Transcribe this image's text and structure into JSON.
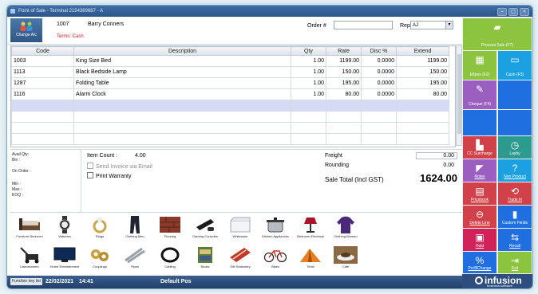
{
  "window": {
    "title": "Point of Sale - Terminal 2154389887 - A"
  },
  "account": {
    "change_label": "Change A/c",
    "code": "1007",
    "name": "Barry Conners",
    "terms": "Terms: Cash"
  },
  "order": {
    "label": "Order #",
    "value": ""
  },
  "rep": {
    "label": "Rep",
    "value": "AJ"
  },
  "table": {
    "headers": [
      "Code",
      "Description",
      "Qty",
      "Rate",
      "Disc %",
      "Extend"
    ],
    "rows": [
      {
        "code": "1003",
        "description": "King Size Bed",
        "qty": "1.00",
        "rate": "1199.00",
        "disc": "0.0000",
        "extend": "1199.00"
      },
      {
        "code": "1113",
        "description": "Black Bedside Lamp",
        "qty": "1.00",
        "rate": "150.00",
        "disc": "0.0000",
        "extend": "150.00"
      },
      {
        "code": "1287",
        "description": "Folding Table",
        "qty": "1.00",
        "rate": "195.00",
        "disc": "0.0000",
        "extend": "195.00"
      },
      {
        "code": "1116",
        "description": "Alarm Clock",
        "qty": "1.00",
        "rate": "80.00",
        "disc": "0.0000",
        "extend": "80.00"
      }
    ]
  },
  "stock": {
    "avail": "Avail Qty:",
    "bin": "Bin :",
    "on_order": "On Order :",
    "min": "Min :",
    "max": "Max :",
    "eoq": "EOQ :"
  },
  "summary": {
    "item_count_label": "Item Count :",
    "item_count": "4.00",
    "send_invoice": "Send Invoice via Email",
    "print_warranty": "Print Warranty",
    "freight_label": "Freight",
    "freight": "0.00",
    "rounding_label": "Rounding",
    "rounding": "0.00",
    "total_label": "Sale Total (Incl GST)",
    "total": "1624.00"
  },
  "categories": [
    {
      "label": "Furniture Bedroom",
      "icon": "bed-icon"
    },
    {
      "label": "Watches",
      "icon": "watch-icon"
    },
    {
      "label": "Rings",
      "icon": "ring-icon"
    },
    {
      "label": "Clothing Men",
      "icon": "trousers-icon"
    },
    {
      "label": "Flooring",
      "icon": "flooring-icon"
    },
    {
      "label": "Gaming Consoles",
      "icon": "console-icon"
    },
    {
      "label": "Whiteware",
      "icon": "freezer-icon"
    },
    {
      "label": "Kitchen Appliances",
      "icon": "pot-icon"
    },
    {
      "label": "Bedroom Electrical",
      "icon": "lamp-icon"
    },
    {
      "label": "Clothing Women",
      "icon": "hoodie-icon"
    },
    {
      "label": "Lawnmowers",
      "icon": "lawnmower-icon"
    },
    {
      "label": "Home Entertainment",
      "icon": "tv-icon"
    },
    {
      "label": "Couplings",
      "icon": "coupling-icon"
    },
    {
      "label": "Pipes",
      "icon": "pipe-icon"
    },
    {
      "label": "Cabling",
      "icon": "cable-icon"
    },
    {
      "label": "Books",
      "icon": "books-icon"
    },
    {
      "label": "Gift Stationery",
      "icon": "gift-icon"
    },
    {
      "label": "Bikes",
      "icon": "bike-icon"
    },
    {
      "label": "Tents",
      "icon": "tent-icon"
    },
    {
      "label": "Cafe",
      "icon": "coffee-icon"
    }
  ],
  "status": {
    "function_key": "Function key list",
    "date": "22/02/2021",
    "time": "14:41",
    "mode": "Default Pos"
  },
  "side_buttons": [
    {
      "label": "Process Sale (F7)",
      "icon": "process-sale-icon",
      "color": "#8cc33f"
    },
    {
      "label": "Eftpos (F2)",
      "icon": "eftpos-icon",
      "color": "#8cc33f"
    },
    {
      "label": "Cash (F3)",
      "icon": "cash-icon",
      "color": "#1ba1e2"
    },
    {
      "label": "Cheque (F4)",
      "icon": "cheque-icon",
      "color": "#9b5fc0"
    },
    {
      "label": "",
      "icon": "",
      "color": "#1f6fe0"
    },
    {
      "label": "",
      "icon": "",
      "color": "#1f6fe0"
    },
    {
      "label": "CC Surcharge",
      "icon": "surcharge-icon",
      "color": "#d1414a"
    },
    {
      "label": "Layby",
      "icon": "clock-icon",
      "color": "#2d9a8e"
    },
    {
      "label": "Notes",
      "icon": "notes-icon",
      "color": "#9b5fc0"
    },
    {
      "label": "Non Product",
      "icon": "question-icon",
      "color": "#1ba1e2"
    },
    {
      "label": "Pricebook",
      "icon": "pricebook-icon",
      "color": "#d1414a"
    },
    {
      "label": "Trade In",
      "icon": "trade-in-icon",
      "color": "#d1414a"
    },
    {
      "label": "Delete Line",
      "icon": "delete-icon",
      "color": "#d1414a"
    },
    {
      "label": "Custom Fields",
      "icon": "custom-fields-icon",
      "color": "#1f6fe0"
    },
    {
      "label": "Hold",
      "icon": "hold-icon",
      "color": "#d1235a"
    },
    {
      "label": "Recall",
      "icon": "recall-icon",
      "color": "#1f6fe0"
    },
    {
      "label": "Pct/$Change",
      "icon": "percent-icon",
      "color": "#1f6fe0"
    },
    {
      "label": "Exit",
      "icon": "exit-icon",
      "color": "#8cc33f"
    }
  ],
  "brand": {
    "name": "infusion",
    "tagline": "business software"
  }
}
